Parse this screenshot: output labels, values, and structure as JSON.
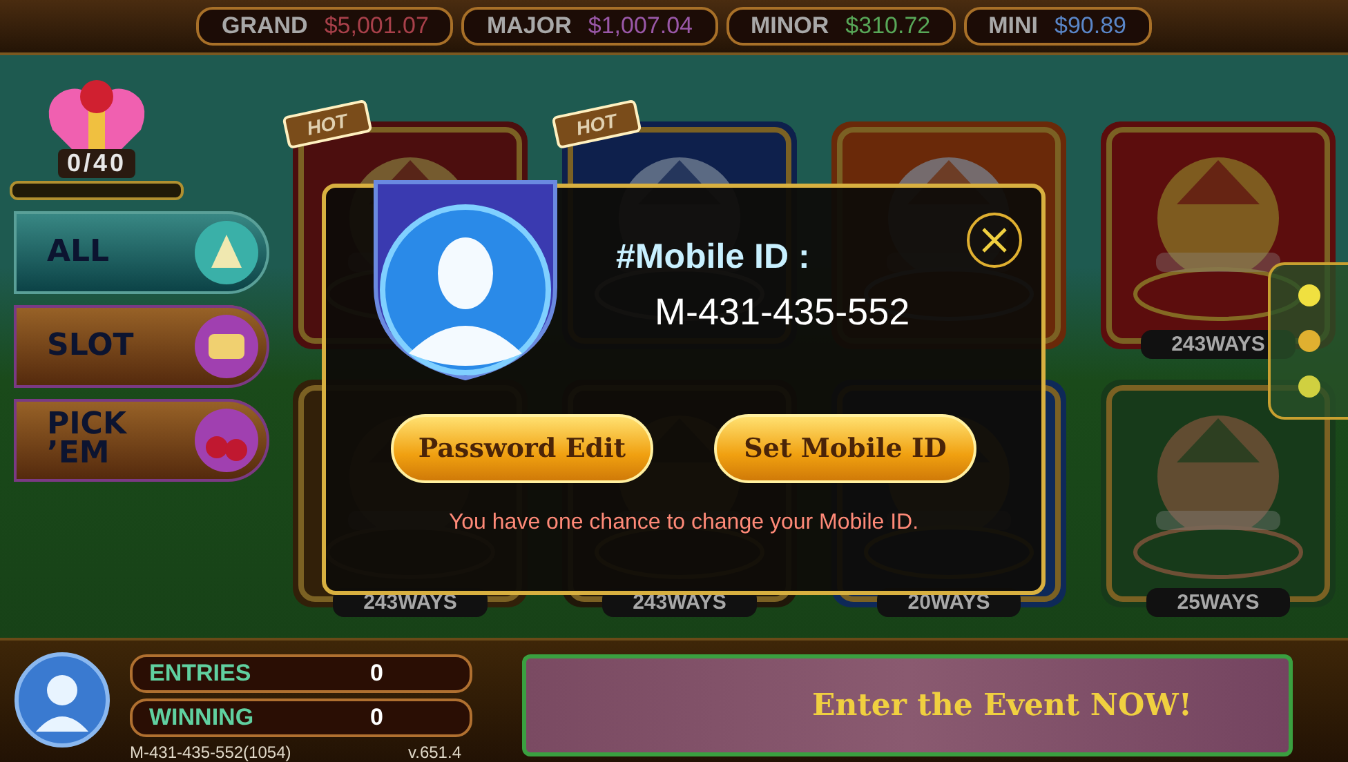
{
  "jackpots": [
    {
      "label": "GRAND",
      "amount": "$5,001.07",
      "color": "#a8404a"
    },
    {
      "label": "MAJOR",
      "amount": "$1,007.04",
      "color": "#9a58a8"
    },
    {
      "label": "MINOR",
      "amount": "$310.72",
      "color": "#58a858"
    },
    {
      "label": "MINI",
      "amount": "$90.89",
      "color": "#5a86c8"
    }
  ],
  "gift": {
    "count": "0/40",
    "level": 0
  },
  "categories": [
    {
      "label": "ALL",
      "selected": true
    },
    {
      "label": "SLOT",
      "selected": false
    },
    {
      "label": "PICK ’EM",
      "selected": false
    }
  ],
  "tiles": [
    {
      "kind": "picture",
      "badge": "HOT"
    },
    {
      "kind": "picture",
      "badge": "HOT"
    },
    {
      "kind": "picture"
    },
    {
      "kind": "picture",
      "ways": "243WAYS"
    },
    {
      "kind": "picture",
      "ways": "243WAYS"
    },
    {
      "kind": "picture",
      "ways": "243WAYS"
    },
    {
      "kind": "picture",
      "ways": "20WAYS"
    },
    {
      "kind": "picture",
      "ways": "25WAYS"
    }
  ],
  "player": {
    "entries_label": "ENTRIES",
    "entries": "0",
    "winning_label": "WINNING",
    "winning": "0",
    "account": "M-431-435-552(1054)",
    "version": "v.651.4"
  },
  "event_banner": {
    "text": "Enter the Event NOW!"
  },
  "dialog": {
    "title": "#Mobile ID :",
    "mobile_id": "M-431-435-552",
    "buttons": [
      "Password Edit",
      "Set Mobile ID"
    ],
    "note": "You have one chance to change your Mobile ID."
  }
}
